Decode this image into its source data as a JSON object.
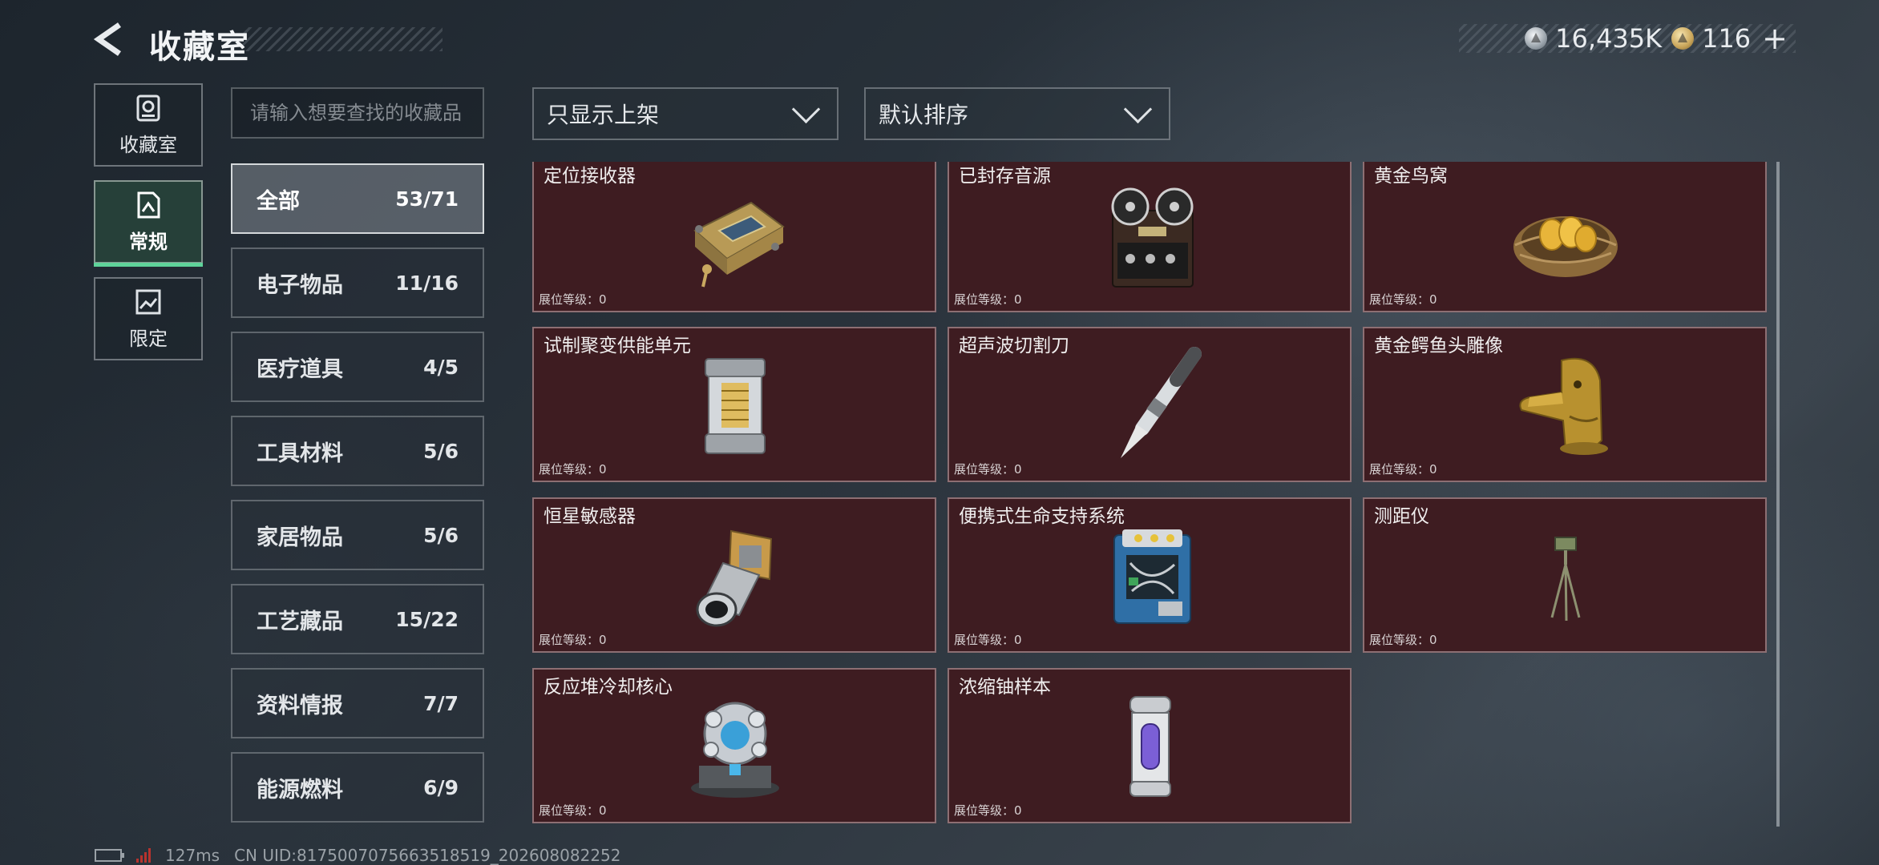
{
  "header": {
    "title": "收藏室",
    "currencies": [
      {
        "icon": "silver-coin-icon",
        "amount": "16,435K"
      },
      {
        "icon": "gold-coin-icon",
        "amount": "116"
      }
    ],
    "plus_label": "+"
  },
  "mode_tabs": [
    {
      "label": "收藏室",
      "icon": "vault-icon",
      "active": false
    },
    {
      "label": "常规",
      "icon": "document-icon",
      "active": true
    },
    {
      "label": "限定",
      "icon": "image-icon",
      "active": false
    }
  ],
  "search": {
    "placeholder": "请输入想要查找的收藏品"
  },
  "categories": [
    {
      "name": "全部",
      "count": "53/71",
      "active": true
    },
    {
      "name": "电子物品",
      "count": "11/16"
    },
    {
      "name": "医疗道具",
      "count": "4/5"
    },
    {
      "name": "工具材料",
      "count": "5/6"
    },
    {
      "name": "家居物品",
      "count": "5/6"
    },
    {
      "name": "工艺藏品",
      "count": "15/22"
    },
    {
      "name": "资料情报",
      "count": "7/7"
    },
    {
      "name": "能源燃料",
      "count": "6/9"
    }
  ],
  "filters": {
    "display": "只显示上架",
    "sort": "默认排序"
  },
  "items": [
    {
      "name": "定位接收器",
      "level": "展位等级：0",
      "icon": "locator-receiver-icon"
    },
    {
      "name": "已封存音源",
      "level": "展位等级：0",
      "icon": "reel-recorder-icon"
    },
    {
      "name": "黄金鸟窝",
      "level": "展位等级：0",
      "icon": "golden-nest-icon"
    },
    {
      "name": "试制聚变供能单元",
      "level": "展位等级：0",
      "icon": "fusion-cell-icon"
    },
    {
      "name": "超声波切割刀",
      "level": "展位等级：0",
      "icon": "ultrasonic-knife-icon"
    },
    {
      "name": "黄金鳄鱼头雕像",
      "level": "展位等级：0",
      "icon": "golden-croc-statue-icon"
    },
    {
      "name": "恒星敏感器",
      "level": "展位等级：0",
      "icon": "star-sensor-icon"
    },
    {
      "name": "便携式生命支持系统",
      "level": "展位等级：0",
      "icon": "life-support-icon"
    },
    {
      "name": "测距仪",
      "level": "展位等级：0",
      "icon": "rangefinder-icon"
    },
    {
      "name": "反应堆冷却核心",
      "level": "展位等级：0",
      "icon": "reactor-core-icon"
    },
    {
      "name": "浓缩铀样本",
      "level": "展位等级：0",
      "icon": "uranium-sample-icon"
    }
  ],
  "footer": {
    "ping": "127ms",
    "uid": "CN UID:8175007075663518519_202608082252"
  },
  "colors": {
    "card_bg": "#3e1c21",
    "active_tab_underline": "#5fd39a",
    "signal": "#b8332e"
  }
}
